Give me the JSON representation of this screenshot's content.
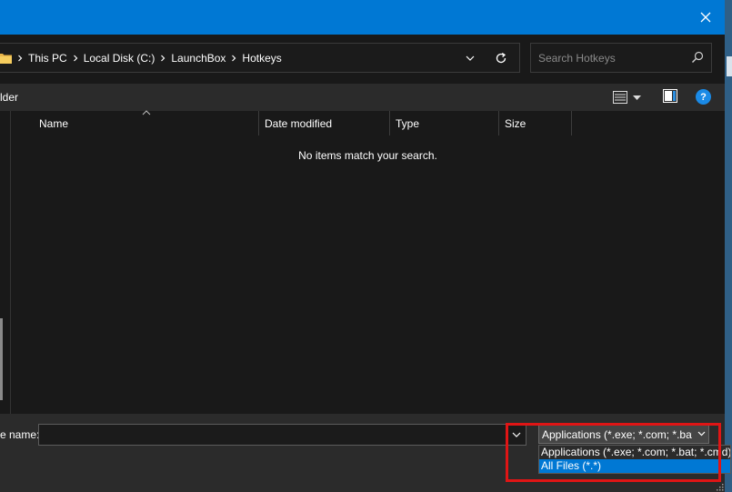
{
  "dialog": {
    "close_icon": "close-icon"
  },
  "address": {
    "breadcrumbs": [
      "This PC",
      "Local Disk (C:)",
      "LaunchBox",
      "Hotkeys"
    ],
    "icons": [
      "folder-icon",
      "chevron-right-icon",
      "chevron-down-icon",
      "refresh-icon"
    ]
  },
  "search": {
    "placeholder": "Search Hotkeys",
    "icon": "search-icon"
  },
  "toolbar": {
    "new_folder_label": "lder",
    "view_icon": "view-menu-icon",
    "preview_pane_icon": "preview-pane-icon",
    "help_label": "?"
  },
  "list": {
    "columns": [
      "Name",
      "Date modified",
      "Type",
      "Size"
    ],
    "empty_message": "No items match your search."
  },
  "bottom": {
    "file_name_label": "e name:",
    "file_name_value": "",
    "file_type_selected": "Applications (*.exe; *.com; *.bat; *.cmd)",
    "file_type_options": [
      "Applications (*.exe; *.com; *.bat; *.cmd)",
      "All Files (*.*)"
    ],
    "selected_option_index": 1
  },
  "colors": {
    "accent": "#0078d4",
    "highlight_box": "#e01515",
    "background": "#191919"
  }
}
